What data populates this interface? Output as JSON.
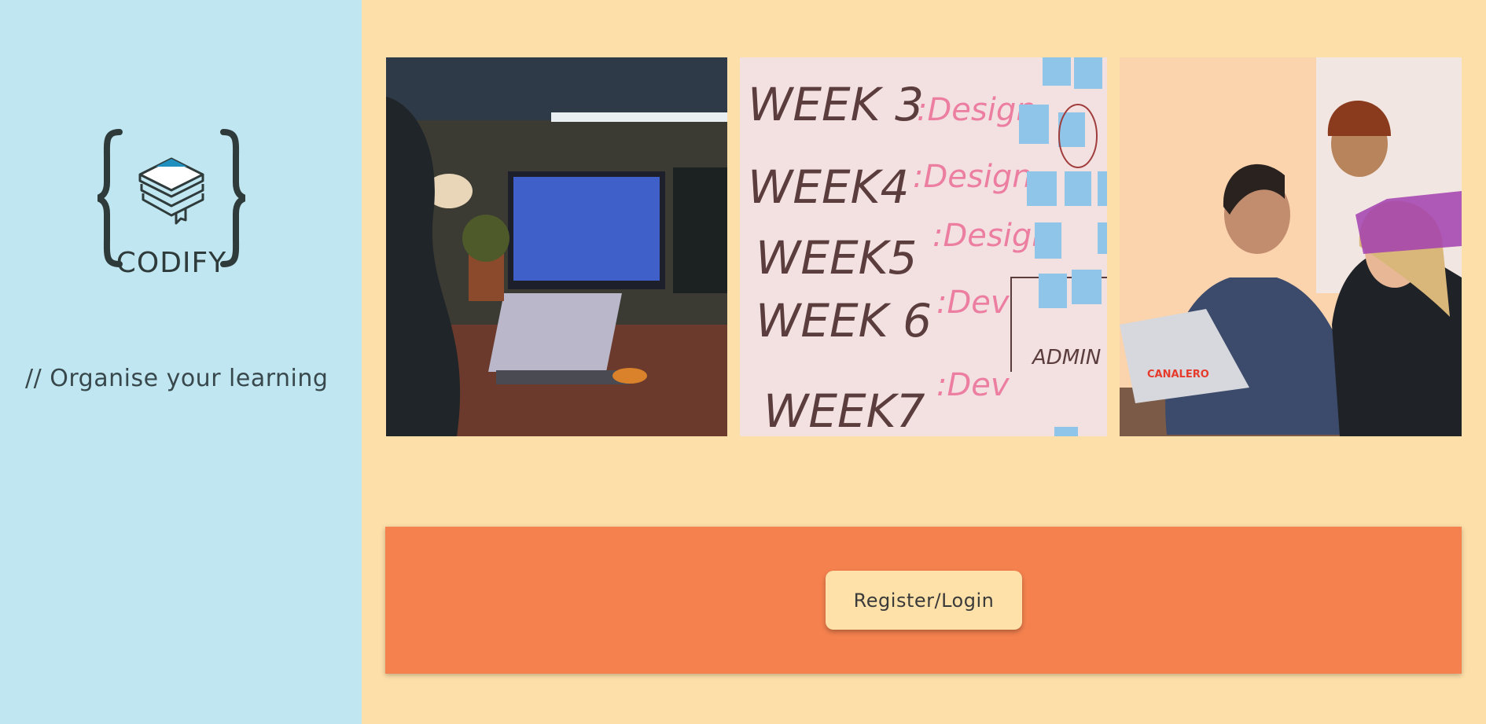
{
  "sidebar": {
    "brand": "CODIFY",
    "logo_icon": "books-in-braces-icon",
    "tagline": "// Organise your learning"
  },
  "gallery": {
    "photos": [
      {
        "subject": "person-coding-at-desk-photo"
      },
      {
        "subject": "whiteboard-week-plan-photo",
        "whiteboard_text": [
          "WEEK 3",
          ":Design",
          "WEEK4",
          ":Design",
          "WEEK5",
          ":Design",
          "WEEK 6",
          ":Dev",
          "WEEK7",
          ":Dev",
          "ADMIN"
        ]
      },
      {
        "subject": "team-at-laptop-photo",
        "sticker_text": "CANALERO"
      }
    ]
  },
  "cta": {
    "button_label": "Register/Login"
  },
  "colors": {
    "sidebar_bg": "#c0e7f1",
    "page_bg": "#fddfa9",
    "cta_bg": "#f4814e",
    "button_bg": "#fee1a8",
    "logo_accent": "#1f8fc0",
    "text_dark": "#2f3b3b"
  }
}
